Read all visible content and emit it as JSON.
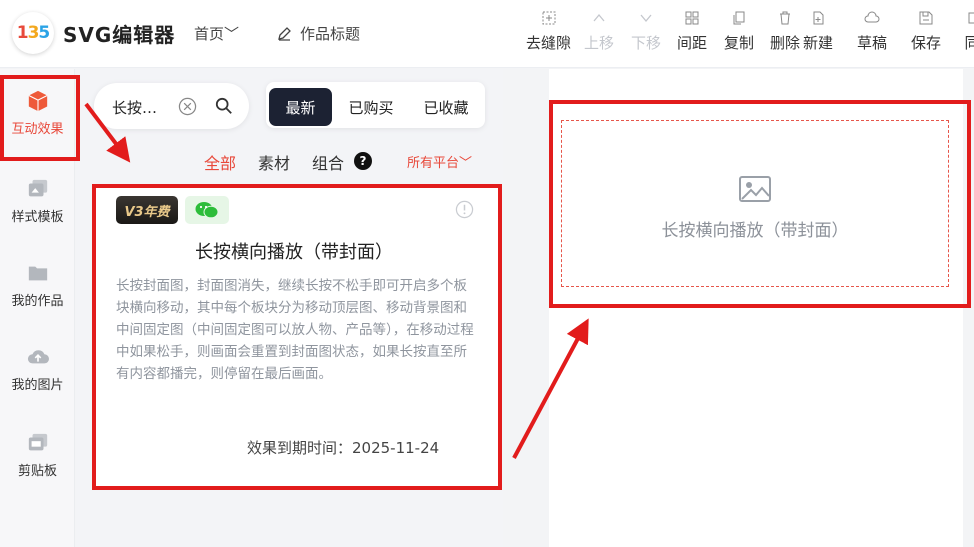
{
  "header": {
    "app_title": "SVG编辑器",
    "nav_home": "首页",
    "work_title": "作品标题",
    "tools": [
      {
        "label": "去缝隙",
        "icon": "gap-icon",
        "enabled": true
      },
      {
        "label": "上移",
        "icon": "chevron-up-icon",
        "enabled": false
      },
      {
        "label": "下移",
        "icon": "chevron-down-icon",
        "enabled": false
      },
      {
        "label": "间距",
        "icon": "spacing-icon",
        "enabled": true
      },
      {
        "label": "复制",
        "icon": "copy-icon",
        "enabled": true
      },
      {
        "label": "删除",
        "icon": "trash-icon",
        "enabled": true
      },
      {
        "label": "新建",
        "icon": "new-file-icon",
        "enabled": true
      },
      {
        "label": "草稿",
        "icon": "cloud-icon",
        "enabled": true
      },
      {
        "label": "保存",
        "icon": "save-icon",
        "enabled": true
      },
      {
        "label": "同",
        "icon": "sync-icon",
        "enabled": true
      }
    ]
  },
  "rail": {
    "items": [
      {
        "label": "互动效果",
        "icon": "cube-icon",
        "active": true
      },
      {
        "label": "样式模板",
        "icon": "template-icon",
        "active": false
      },
      {
        "label": "我的作品",
        "icon": "folder-icon",
        "active": false
      },
      {
        "label": "我的图片",
        "icon": "cloud-upload-icon",
        "active": false
      },
      {
        "label": "剪贴板",
        "icon": "clipboard-icon",
        "active": false
      }
    ]
  },
  "search": {
    "value": "长按…"
  },
  "tabs": [
    "最新",
    "已购买",
    "已收藏"
  ],
  "filters": {
    "items": [
      "全部",
      "素材",
      "组合"
    ],
    "help_badge": "?",
    "platform": "所有平台"
  },
  "card": {
    "badge_v3": "V3年费",
    "title": "长按横向播放（带封面）",
    "description": "长按封面图，封面图消失，继续长按不松手即可开启多个板块横向移动，其中每个板块分为移动顶层图、移动背景图和中间固定图（中间固定图可以放人物、产品等），在移动过程中如果松手，则画面会重置到封面图状态，如果长按直至所有内容都播完，则停留在最后画面。",
    "expire_label": "效果到期时间：2025-11-24"
  },
  "canvas": {
    "placeholder_text": "长按横向播放（带封面）"
  },
  "colors": {
    "accent": "#e8483a",
    "highlight": "#e21c1c",
    "dark_tab": "#1c2233"
  }
}
